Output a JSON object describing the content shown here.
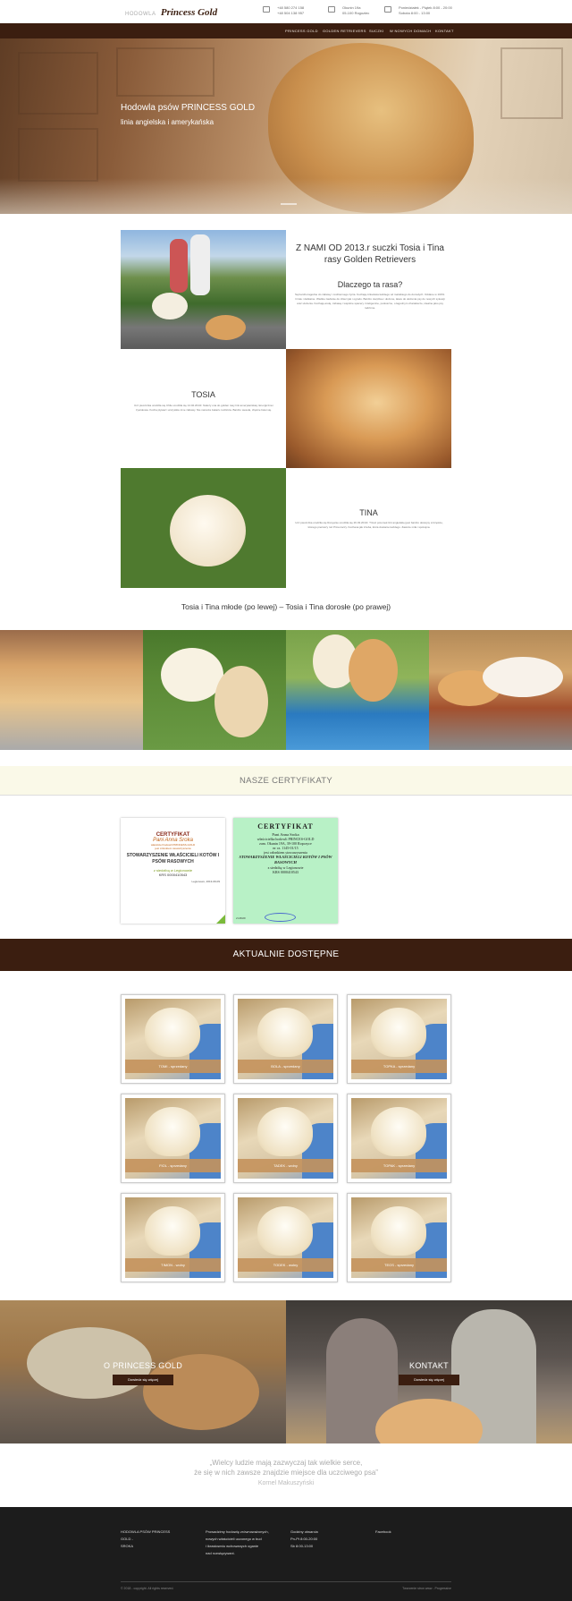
{
  "header": {
    "logo_small": "HODOWLA",
    "logo_main": "Princess Gold",
    "phone1": "+48 580 274 158",
    "phone2": "+48 504 138 957",
    "address1": "Okunin 19a",
    "address2": "05-100 Rogoziec",
    "hours1": "Poniedziałek - Piątek 8:00 - 20:00",
    "hours2": "Sobota 8:00 - 13:00"
  },
  "nav": [
    "PRINCESS GOLD",
    "GOLDEN RETRIEVERS",
    "SUCZKI",
    "W NOWYCH DOMACH",
    "KONTAKT"
  ],
  "hero": {
    "title": "Hodowla psów PRINCESS GOLD",
    "subtitle": "linia angielska i amerykańska"
  },
  "intro": {
    "title": "Z NAMI OD 2013.r suczki Tosia i Tina rasy Golden Retrievers",
    "why_title": "Dlaczego ta rasa?",
    "why_text": "Są bardzo łagodne do zabawy i codziennego życia. Kochają człowieka każdego od malutkiego do dorosłych. Oddane w 100%. Czułe i delikatne. Wielkie zaufanie do dzieci jak i ogrodu. Bardzo cierpliwe i ułożone, łatwe do ułożenia psy do nowych sytuacji oraz ułożenia. Kochają wodę, zabawę i wspólne spacery. Inteligentne, posłuszne, o łagodnym charakterze, idealne jako psy rodzinne."
  },
  "tosia": {
    "title": "TOSIA",
    "text": "Ucz pieszczka urodziła się Chile urodziła się 14.02.2013r. Należy ona do golden rasy linii amerykańskiej. Energiczna i żywiołowa. Kocha pływać i wszystkie inne zabawy. Nie narusza zakazu rodziców. Bardzo wesoła, chętnie bawi się."
  },
  "tina": {
    "title": "TINA",
    "text": "Ucz pieszczka urodziła się Rosyanie urodziła się 26.03.2013r. Trzeci potomek linii angielskiej jest bardzo dostojny szczęście, którego pierwszy raz Przeuroczy. Kochana jak trzeba, która dostanie każdego. Zawsze miła i spokojna."
  },
  "caption": "Tosia i Tina młode (po lewej) – Tosia i Tina dorosłe (po prawej)",
  "certs": {
    "title": "NASZE CERTYFIKATY",
    "c1": {
      "heading": "CERTYFIKAT",
      "name": "Pani Anna Sroka",
      "line1": "właściciel hodowli PRINCESS-GOLD",
      "line2": "jest członkiem stowarzyszenia",
      "org": "STOWARZYSZENIE WŁAŚCICIELI KOTÓW I PSÓW RASOWYCH",
      "seat": "z siedzibą w Legionowie",
      "krs": "KRS 0000410543",
      "date": "Legionowo, 2013-09-09"
    },
    "c2": {
      "heading": "CERTYFIKAT",
      "name": "Pani Anna Sroka",
      "line1": "właścicielka hodowli PRINCES-GOLD",
      "line2": "zam. Okunin 19A, 39-100 Ropczyce",
      "line3": "nr cz. 1145-01/15",
      "line4": "jest członkiem stowarzyszenia",
      "org": "STOWARZYSZENIE WŁAŚCICIELI KOTÓW I PSÓW RASOWYCH",
      "seat": "z siedzibą w Legionowie",
      "krs": "KRS 0000410543",
      "date": "21.09.09"
    }
  },
  "available": {
    "title": "AKTUALNIE DOSTĘPNE",
    "cards": [
      "TOMI - sprzedany",
      "BOLA - sprzedany",
      "TOPKA - sprzedany",
      "FIOL - sprzedany",
      "TADEK - wolny",
      "TOPAK - sprzedany",
      "TIMON - wolny",
      "TODEK - wolny",
      "TEOS - sprzedany"
    ]
  },
  "cta": {
    "left_title": "O PRINCESS GOLD",
    "right_title": "KONTAKT",
    "button": "Dowiedz się więcej"
  },
  "quote": {
    "line1": "„Wielcy ludzie mają zazwyczaj tak wielkie serce,",
    "line2": "że się w nich zawsze znajdzie miejsce dla uczciwego psa”",
    "author": "Kornel Makuszyński"
  },
  "footer": {
    "col1": [
      "HODOWLA PSÓW PRINCESS GOLD -",
      "SROKA"
    ],
    "col2": [
      "Prowadzimy hodowlę zrównoważonych,",
      "nowych właścicieli uczonego w bud",
      "i ikrastowniu wchowanych oganie",
      "nad rozwiązywani."
    ],
    "col3": [
      "Godziny otwarcia",
      "Pn-Pt 8:00-20:00",
      "Sb 8:00-13:00"
    ],
    "col4": "Facebook",
    "copyright": "© 2018 - copyright. All rights reserved.",
    "credit": "Tworzenie stron www - Progressive"
  }
}
